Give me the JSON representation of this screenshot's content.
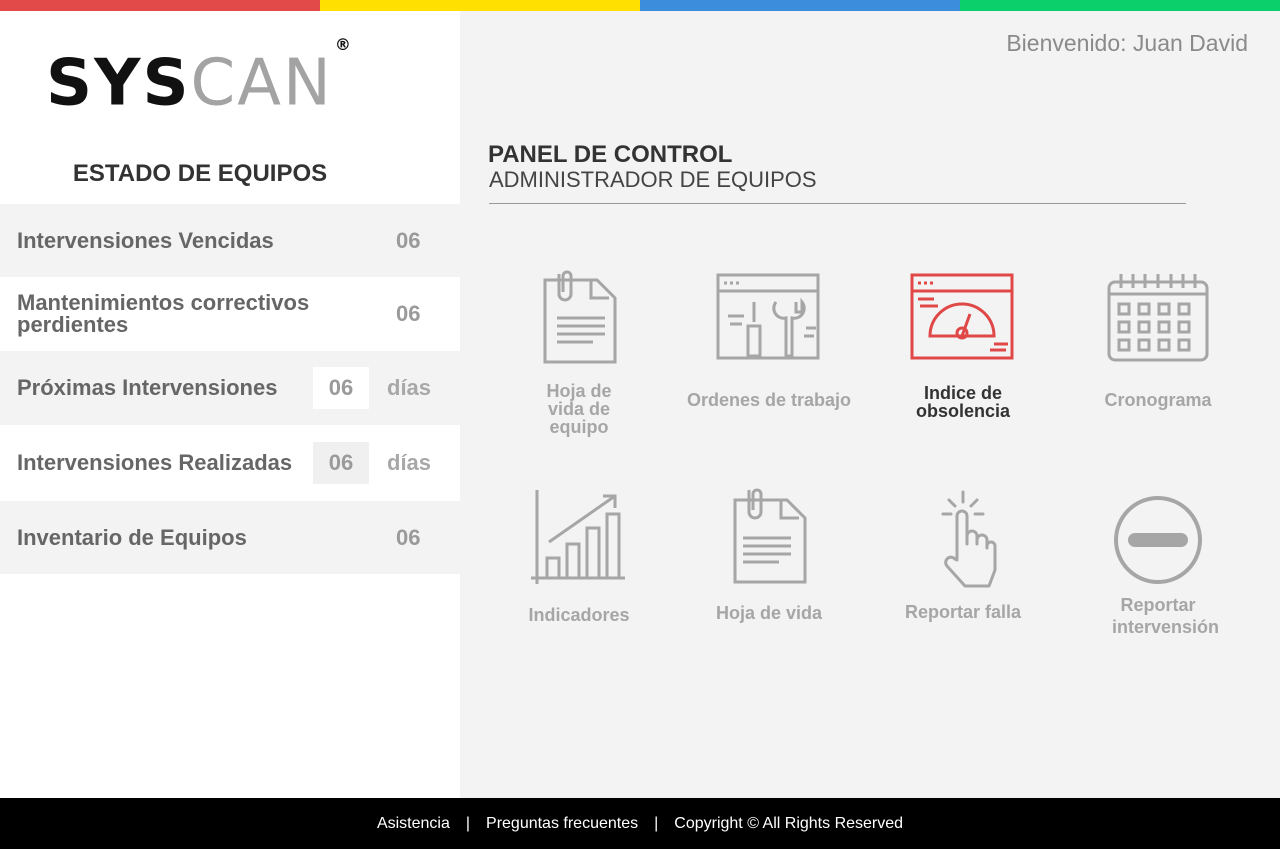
{
  "brand": {
    "logo_part1": "SYS",
    "logo_part2": "CAN",
    "registered": "®"
  },
  "colors": {
    "bar1": "#e24a4a",
    "bar2": "#ffe000",
    "bar3": "#3c8ddc",
    "bar4": "#0bcf6a",
    "accent_red": "#e04848",
    "icon_gray": "#a6a6a6"
  },
  "header": {
    "welcome": "Bienvenido: Juan David"
  },
  "sidebar": {
    "title": "ESTADO DE EQUIPOS",
    "rows": [
      {
        "label": "Intervensiones Vencidas",
        "value": "06"
      },
      {
        "label": "Mantenimientos correctivos perdientes",
        "value": "06"
      },
      {
        "label": "Próximas Intervensiones",
        "value": "06",
        "unit": "días"
      },
      {
        "label": "Intervensiones Realizadas",
        "value": "06",
        "unit": "días"
      },
      {
        "label": "Inventario de Equipos",
        "value": "06"
      }
    ]
  },
  "panel": {
    "title": "PANEL DE CONTROL",
    "subtitle": "ADMINISTRADOR DE EQUIPOS"
  },
  "tiles": [
    {
      "label": "Hoja de vida de equipo",
      "icon": "document-clip-icon"
    },
    {
      "label": "Ordenes de trabajo",
      "icon": "tools-window-icon"
    },
    {
      "label": "Indice de obsolencia",
      "icon": "speedometer-window-icon",
      "active": true
    },
    {
      "label": "Cronograma",
      "icon": "calendar-icon"
    },
    {
      "label": "Indicadores",
      "icon": "bar-chart-icon"
    },
    {
      "label": "Hoja de vida",
      "icon": "document-clip-icon"
    },
    {
      "label": "Reportar falla",
      "icon": "tap-hand-icon"
    },
    {
      "label": "Reportar intervensión",
      "icon": "minus-circle-icon"
    }
  ],
  "footer": {
    "link1": "Asistencia",
    "sep": "|",
    "link2": "Preguntas frecuentes",
    "copyright": "Copyright © All Rights Reserved"
  }
}
